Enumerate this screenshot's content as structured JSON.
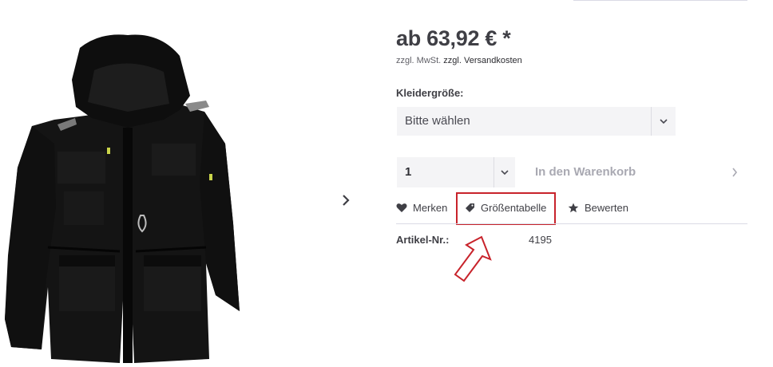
{
  "buybox": {
    "price": "ab 63,92 € *",
    "tax_note": "zzgl. MwSt.",
    "shipping_link": "zzgl. Versandkosten"
  },
  "variant": {
    "label": "Kleidergröße:",
    "select_value": "Bitte wählen"
  },
  "cart": {
    "quantity": "1",
    "add_to_cart_label": "In den Warenkorb"
  },
  "actions": {
    "remember": "Merken",
    "size_chart": "Größentabelle",
    "rate": "Bewerten"
  },
  "details": {
    "article_no_label": "Artikel-Nr.:",
    "article_no_value": "4195"
  },
  "icons": {
    "remember": "heart-icon",
    "size_chart": "tag-icon",
    "rate": "star-icon",
    "image_next": "chevron-right-icon",
    "select_arrow": "chevron-down-icon",
    "cart_arrow": "chevron-right-icon"
  },
  "colors": {
    "highlight": "#c8232b",
    "select_bg": "#f4f4f6",
    "jacket": "#111111"
  }
}
